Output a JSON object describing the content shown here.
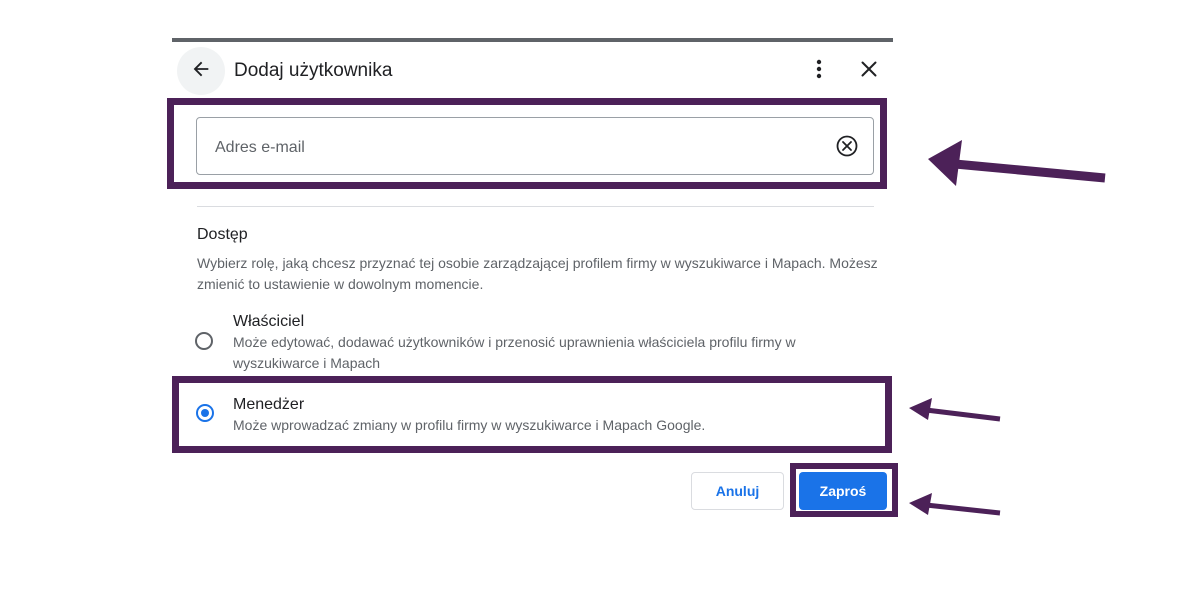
{
  "header": {
    "title": "Dodaj użytkownika",
    "back_icon": "arrow-back-icon",
    "more_icon": "more-vert-icon",
    "close_icon": "close-icon"
  },
  "email_field": {
    "placeholder": "Adres e-mail",
    "value": "",
    "clear_icon": "clear-circle-icon"
  },
  "access": {
    "title": "Dostęp",
    "description": "Wybierz rolę, jaką chcesz przyznać tej osobie zarządzającej profilem firmy w wyszukiwarce i Mapach. Możesz zmienić to ustawienie w dowolnym momencie.",
    "options": [
      {
        "label": "Właściciel",
        "description": "Może edytować, dodawać użytkowników i przenosić uprawnienia właściciela profilu firmy w wyszukiwarce i Mapach",
        "selected": false
      },
      {
        "label": "Menedżer",
        "description": "Może wprowadzać zmiany w profilu firmy w wyszukiwarce i Mapach Google.",
        "selected": true
      }
    ]
  },
  "actions": {
    "cancel_label": "Anuluj",
    "invite_label": "Zaproś"
  },
  "colors": {
    "accent": "#1a73e8",
    "highlight": "#4c2158"
  }
}
